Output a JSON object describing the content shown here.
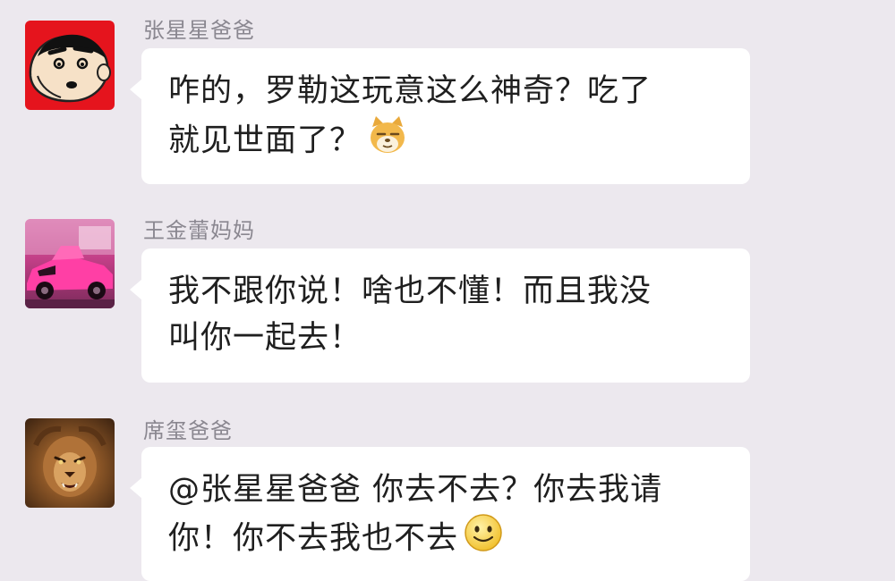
{
  "chat": {
    "messages": [
      {
        "sender": "张星星爸爸",
        "avatar_icon": "crayon-shin-chan-avatar-icon",
        "lines": [
          "咋的，罗勒这玩意这么神奇？吃了",
          "就见世面了？"
        ],
        "trailing_emoji": "doge-emoji-icon"
      },
      {
        "sender": "王金蕾妈妈",
        "avatar_icon": "pink-sports-car-avatar-icon",
        "lines": [
          "我不跟你说！啥也不懂！而且我没",
          "叫你一起去！"
        ]
      },
      {
        "sender": "席玺爸爸",
        "avatar_icon": "lion-avatar-icon",
        "lines": [
          "@张星星爸爸 你去不去？你去我请",
          "你！你不去我也不去"
        ],
        "trailing_emoji": "smile-emoji-icon"
      }
    ]
  }
}
